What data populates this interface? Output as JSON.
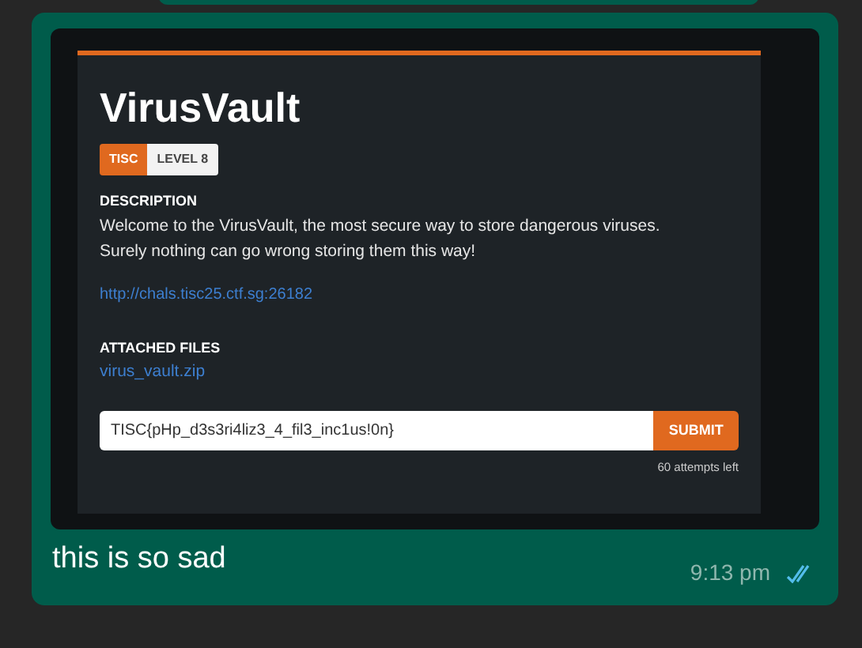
{
  "message": {
    "image": {
      "title": "VirusVault",
      "tags": [
        "TISC",
        "LEVEL 8"
      ],
      "description_heading": "DESCRIPTION",
      "description": "Welcome to the VirusVault, the most secure way to store dangerous viruses. Surely nothing can go wrong storing them this way!",
      "link": "http://chals.tisc25.ctf.sg:26182",
      "files_heading": "ATTACHED FILES",
      "file": "virus_vault.zip",
      "flag_input": {
        "value": "TISC{pHp_d3s3ri4liz3_4_fil3_inc1us!0n}"
      },
      "submit": "SUBMIT",
      "attempts": "60 attempts left"
    },
    "caption": "this is so sad",
    "time": "9:13 pm",
    "read": true
  }
}
